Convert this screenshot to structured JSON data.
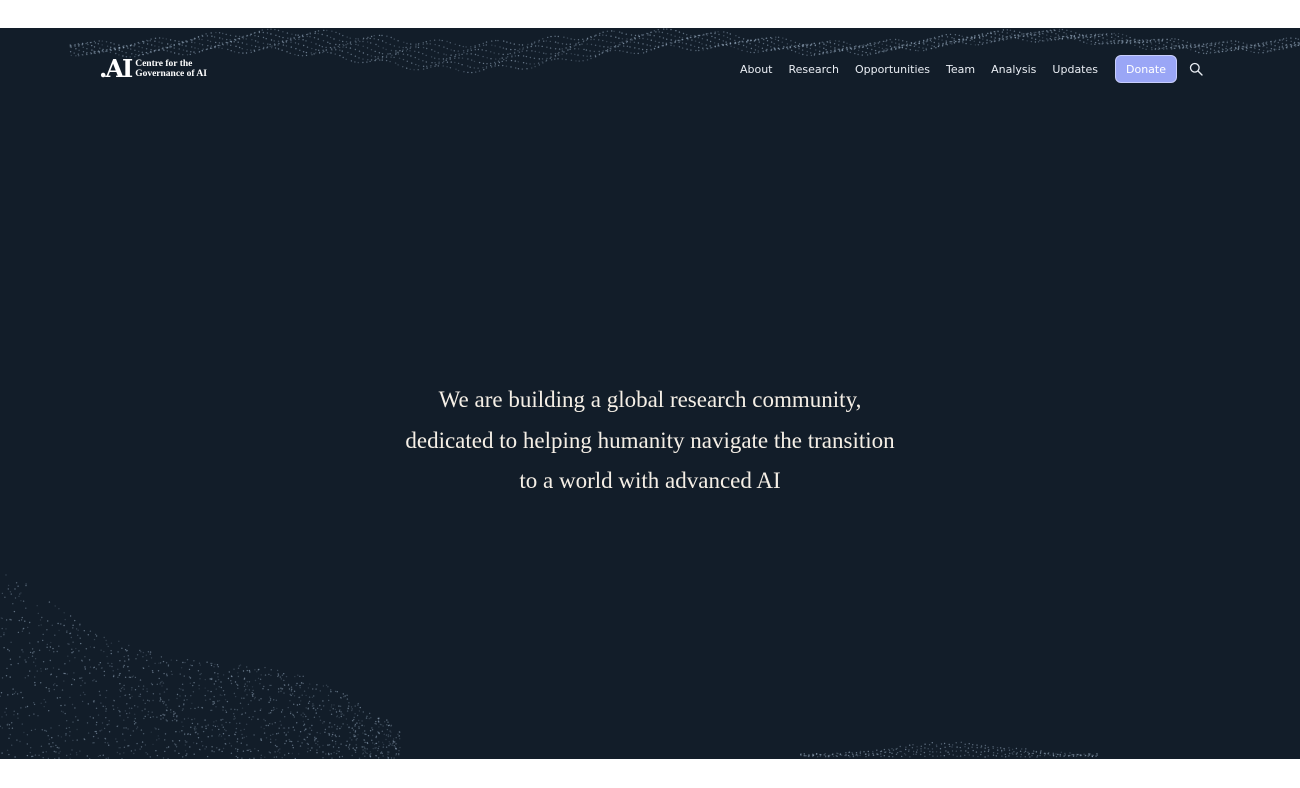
{
  "brand": {
    "mark": ".AI",
    "line1": "Centre for the",
    "line2": "Governance of AI"
  },
  "nav": {
    "items": [
      "About",
      "Research",
      "Opportunities",
      "Team",
      "Analysis",
      "Updates"
    ],
    "donate_label": "Donate",
    "search_icon": "search-icon"
  },
  "hero": {
    "line1": "We are building a global research community,",
    "line2": "dedicated to helping humanity navigate the transition",
    "line3": "to a world with advanced AI"
  },
  "colors": {
    "background": "#121d29",
    "accent": "#9aa6f6",
    "text": "#f5efe6"
  }
}
